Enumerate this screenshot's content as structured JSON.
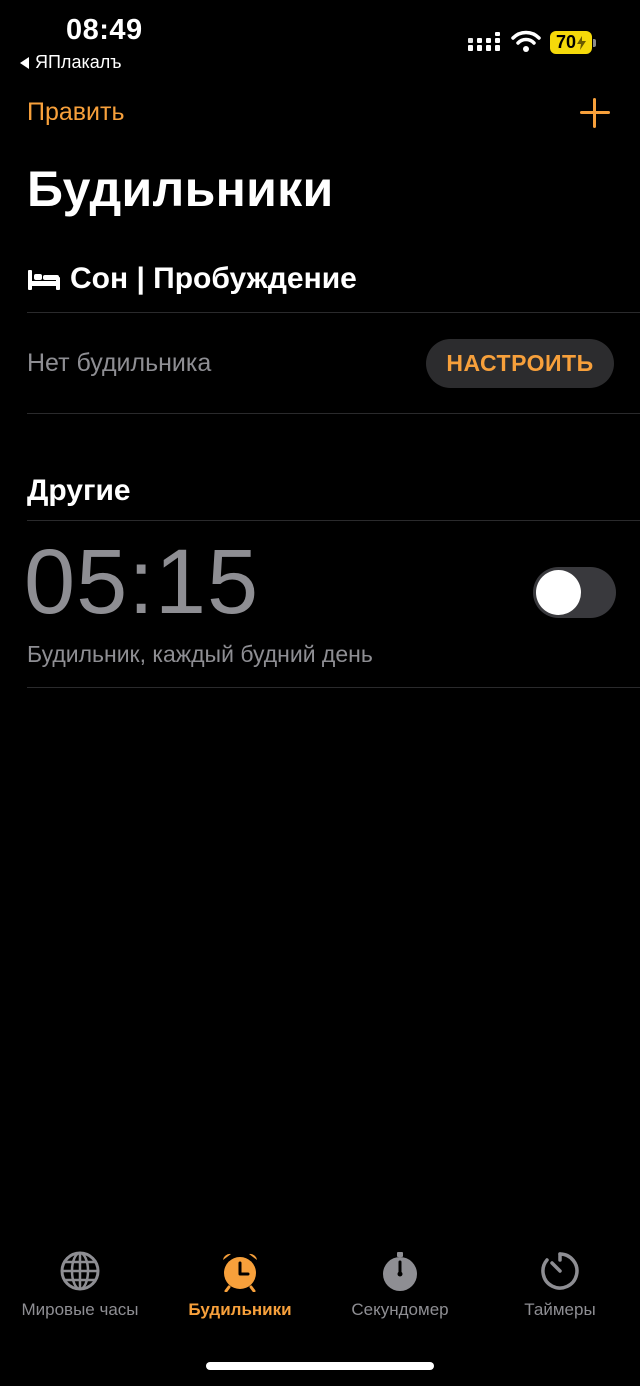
{
  "status_bar": {
    "time": "08:49",
    "back_app": "ЯПлакалъ",
    "battery": "70"
  },
  "nav": {
    "edit_label": "Править",
    "add_icon": "plus-icon"
  },
  "page_title": "Будильники",
  "sleep": {
    "header": "Сон | Пробуждение",
    "no_alarm": "Нет будильника",
    "setup_label": "НАСТРОИТЬ"
  },
  "other": {
    "header": "Другие",
    "alarms": [
      {
        "time": "05:15",
        "label": "Будильник, каждый будний день",
        "enabled": false
      }
    ]
  },
  "tabs": [
    {
      "label": "Мировые часы",
      "icon": "globe-icon",
      "active": false
    },
    {
      "label": "Будильники",
      "icon": "alarm-clock-icon",
      "active": true
    },
    {
      "label": "Секундомер",
      "icon": "stopwatch-icon",
      "active": false
    },
    {
      "label": "Таймеры",
      "icon": "timer-icon",
      "active": false
    }
  ],
  "colors": {
    "accent": "#f7a03b",
    "secondary_text": "#8e8e93",
    "background": "#000000",
    "battery": "#f5d90a"
  }
}
